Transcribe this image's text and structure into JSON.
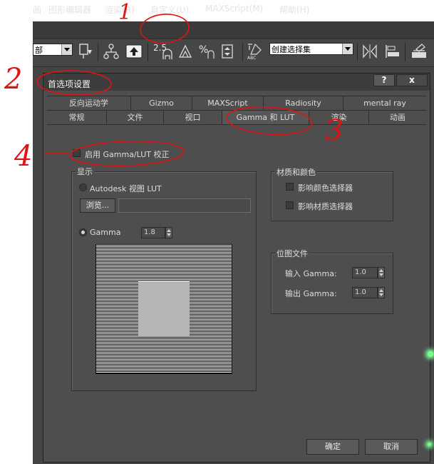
{
  "menubar": {
    "items": [
      {
        "label": "画"
      },
      {
        "label": "图形编辑器"
      },
      {
        "label": "渲染(R)"
      },
      {
        "label": "自定义(U)"
      },
      {
        "label": "MAXScript(M)"
      },
      {
        "label": "帮助(H)"
      }
    ]
  },
  "toolbar": {
    "view_select": "部",
    "snap_angle": "2.5",
    "selection_set": "创建选择集"
  },
  "dialog": {
    "title": "首选项设置",
    "help_button": "?",
    "close_button": "x",
    "tabs_row1": [
      {
        "label": "反向运动学"
      },
      {
        "label": "Gizmo"
      },
      {
        "label": "MAXScript"
      },
      {
        "label": "Radiosity"
      },
      {
        "label": "mental ray"
      }
    ],
    "tabs_row2": [
      {
        "label": "常规"
      },
      {
        "label": "文件"
      },
      {
        "label": "视口"
      },
      {
        "label": "Gamma 和 LUT",
        "active": true
      },
      {
        "label": "渲染"
      },
      {
        "label": "动画"
      }
    ],
    "enable_gamma_lut": {
      "label": "启用 Gamma/LUT 校正",
      "checked": false
    },
    "display": {
      "group_label": "显示",
      "autodesk_lut": {
        "label": "Autodesk 视图 LUT",
        "selected": false
      },
      "browse_button": "浏览...",
      "lut_path": "",
      "gamma": {
        "label": "Gamma",
        "selected": true,
        "value": "1.8"
      }
    },
    "materials": {
      "group_label": "材质和颜色",
      "affect_color_selector": {
        "label": "影响颜色选择器",
        "checked": false
      },
      "affect_material_selector": {
        "label": "影响材质选择器",
        "checked": false
      }
    },
    "bitmap_files": {
      "group_label": "位图文件",
      "input_gamma": {
        "label": "输入 Gamma:",
        "value": "1.0"
      },
      "output_gamma": {
        "label": "输出 Gamma:",
        "value": "1.0"
      }
    },
    "ok_button": "确定",
    "cancel_button": "取消"
  },
  "annotations": {
    "step1": "1",
    "step2": "2",
    "step3": "3",
    "step4": "4"
  },
  "colors": {
    "app_background": "#444444",
    "dialog_background": "#4e4e4e",
    "annotation_red": "#e01212",
    "swatch_gray": "#b6b6b6"
  }
}
